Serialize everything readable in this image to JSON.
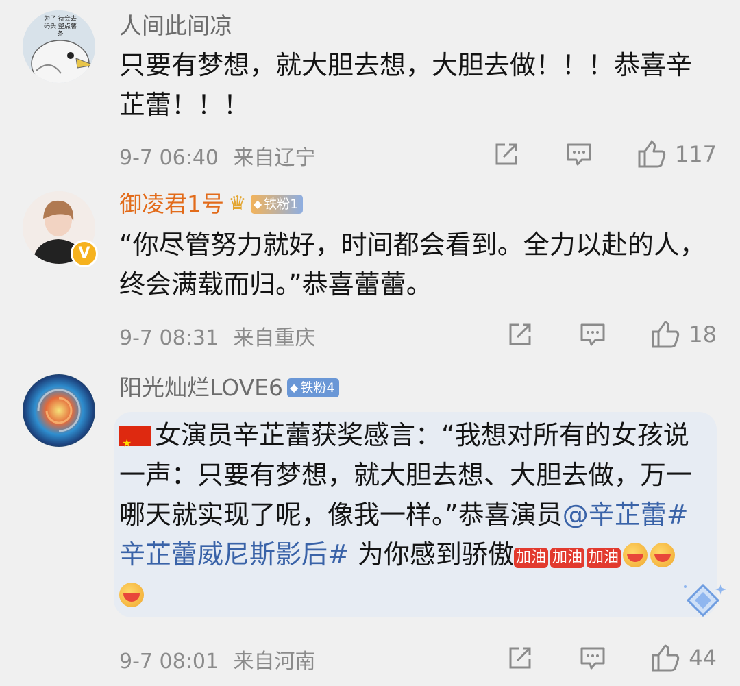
{
  "comments": [
    {
      "username": "人间此间凉",
      "avatar_caption": "为了 待会去码头 整点薯条",
      "text": "只要有梦想，就大胆去想，大胆去做！！！恭喜辛芷蕾！！！",
      "time": "9-7 06:40",
      "location": "来自辽宁",
      "likes": "117"
    },
    {
      "username": "御凌君1号",
      "badge": "铁粉1",
      "verified_mark": "V",
      "text": "“你尽管努力就好，时间都会看到。全力以赴的人，终会满载而归。”恭喜蕾蕾。",
      "time": "9-7 08:31",
      "location": "来自重庆",
      "likes": "18"
    },
    {
      "username": "阳光灿烂LOVE6",
      "badge": "铁粉4",
      "text_part1": "女演员辛芷蕾获奖感言：“我想对所有的女孩说一声：只要有梦想，就大胆去想、大胆去做，万一哪天就实现了呢，像我一样。”恭喜演员",
      "mention": "@辛芷蕾",
      "hashtag": "#辛芷蕾威尼斯影后#",
      "text_part2": " 为你感到骄傲",
      "emoji_jiayou": "加油",
      "time": "9-7 08:01",
      "location": "来自河南",
      "likes": "44"
    }
  ],
  "icons": [
    "share-icon",
    "comment-icon",
    "like-icon",
    "crown-icon",
    "diamond-icon",
    "china-flag-icon",
    "hug-emoji-icon"
  ],
  "colors": {
    "background": "#f0f0f0",
    "username": "#6c6c6c",
    "vip_username": "#e26b1a",
    "link": "#3a63a8",
    "meta": "#8b8b8b",
    "highlight": "#e7ecf3"
  }
}
